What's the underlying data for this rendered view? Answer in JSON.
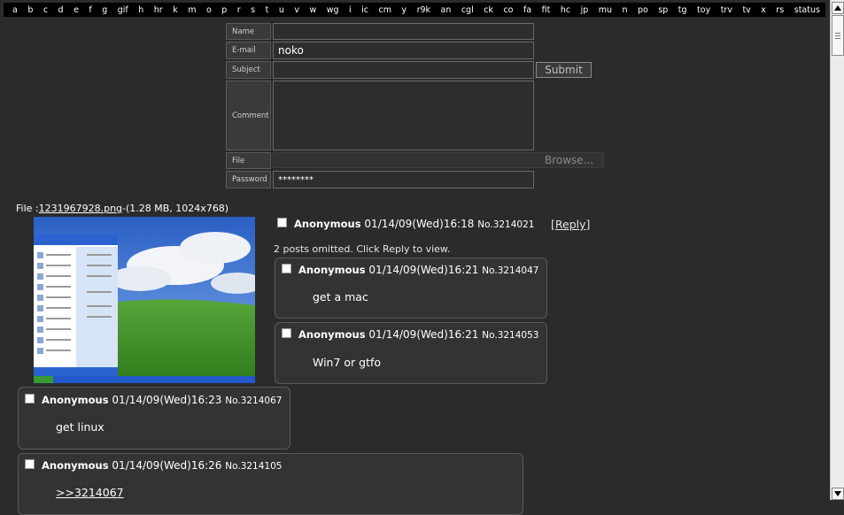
{
  "boardnav": [
    "a",
    "b",
    "c",
    "d",
    "e",
    "f",
    "g",
    "gif",
    "h",
    "hr",
    "k",
    "m",
    "o",
    "p",
    "r",
    "s",
    "t",
    "u",
    "v",
    "w",
    "wg",
    "i",
    "ic",
    "cm",
    "y",
    "r9k",
    "an",
    "cgl",
    "ck",
    "co",
    "fa",
    "fit",
    "hc",
    "jp",
    "mu",
    "n",
    "po",
    "sp",
    "tg",
    "toy",
    "trv",
    "tv",
    "x",
    "rs",
    "status"
  ],
  "form": {
    "name_label": "Name",
    "name_value": "",
    "email_label": "E-mail",
    "email_value": "noko",
    "subject_label": "Subject",
    "subject_value": "",
    "submit_label": "Submit",
    "comment_label": "Comment",
    "comment_value": "",
    "file_label": "File",
    "browse_label": "Browse...",
    "password_label": "Password",
    "password_value": "********"
  },
  "op": {
    "file_prefix": "File :",
    "file_name": "1231967928.png",
    "file_meta": "-(1.28 MB, 1024x768)",
    "name": "Anonymous",
    "date": "01/14/09(Wed)16:18",
    "number": "No.3214021",
    "reply_link": "[Reply]",
    "omitted": "2 posts omitted. Click Reply to view."
  },
  "replies": [
    {
      "name": "Anonymous",
      "date": "01/14/09(Wed)16:21",
      "number": "No.3214047",
      "message": "get a mac",
      "quote": ""
    },
    {
      "name": "Anonymous",
      "date": "01/14/09(Wed)16:21",
      "number": "No.3214053",
      "message": "Win7 or gtfo",
      "quote": ""
    },
    {
      "name": "Anonymous",
      "date": "01/14/09(Wed)16:23",
      "number": "No.3214067",
      "message": "get linux",
      "quote": ""
    },
    {
      "name": "Anonymous",
      "date": "01/14/09(Wed)16:26",
      "number": "No.3214105",
      "message": "",
      "quote": ">>3214067"
    }
  ],
  "icons": {
    "scroll_up": "arrow-up-icon",
    "scroll_down": "arrow-down-icon"
  }
}
